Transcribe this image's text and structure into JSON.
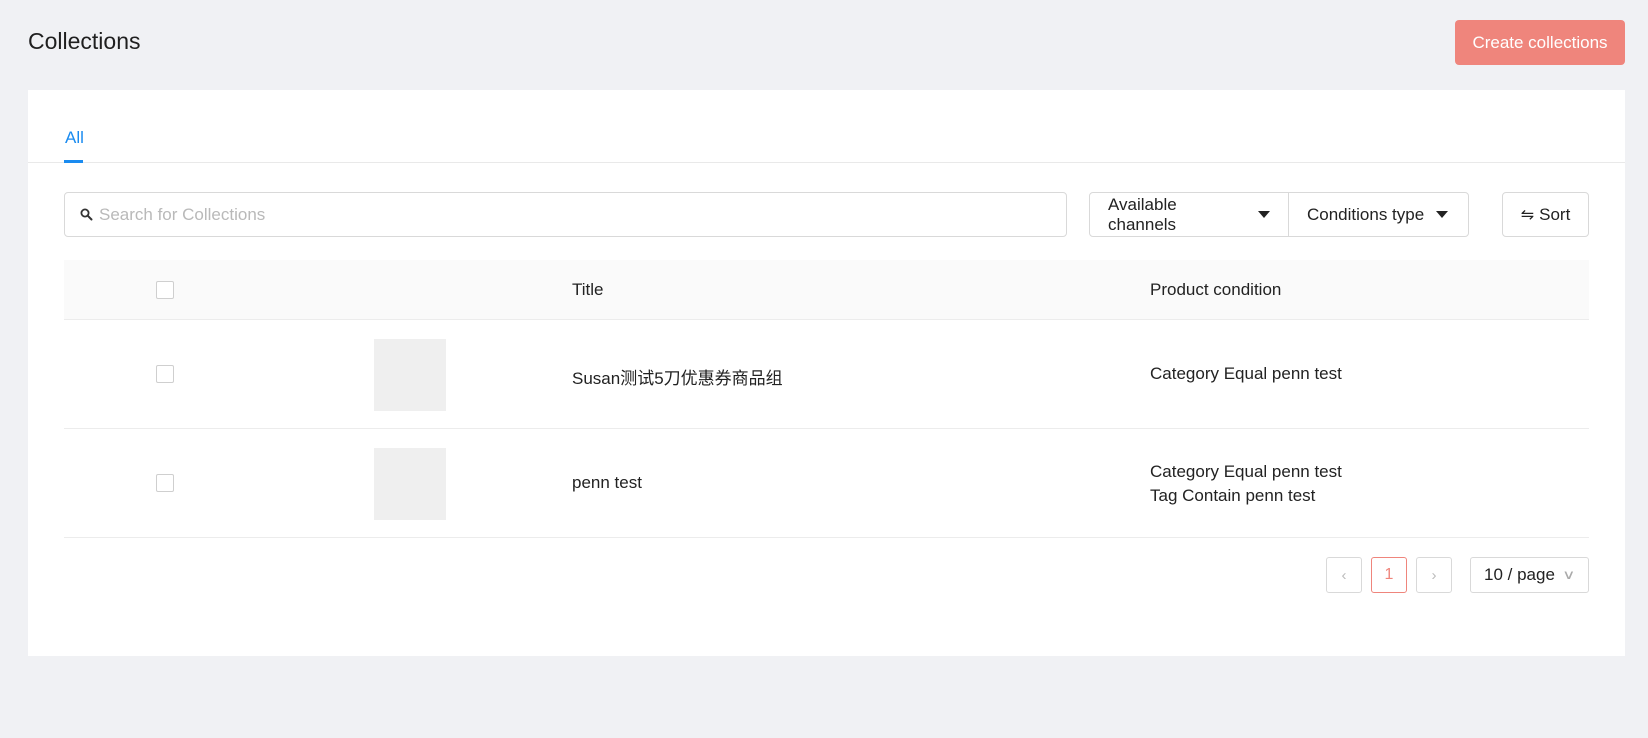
{
  "header": {
    "title": "Collections",
    "create_label": "Create collections"
  },
  "tabs": [
    {
      "label": "All",
      "active": true
    }
  ],
  "search": {
    "placeholder": "Search for Collections",
    "value": ""
  },
  "filters": {
    "channels_label": "Available channels",
    "conditions_label": "Conditions type",
    "sort_label": "Sort"
  },
  "table": {
    "columns": [
      "",
      "",
      "Title",
      "Product condition"
    ],
    "rows": [
      {
        "title": "Susan测试5刀优惠券商品组",
        "conditions": [
          "Category Equal penn test"
        ]
      },
      {
        "title": "penn test",
        "conditions": [
          "Category Equal penn test",
          "Tag Contain penn test"
        ]
      }
    ]
  },
  "pagination": {
    "current_page": "1",
    "page_size_label": "10 / page"
  },
  "colors": {
    "accent": "#ef857c",
    "tab_active": "#1a8bf0",
    "background": "#f0f1f4"
  }
}
